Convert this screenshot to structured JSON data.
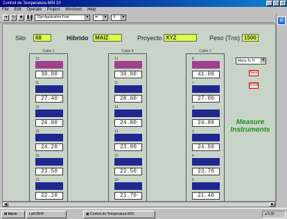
{
  "window": {
    "title": "Control de Temperatura MSI 10"
  },
  "menu": [
    "File",
    "Edit",
    "Operate",
    "Project",
    "Windows",
    "Help"
  ],
  "toolbar": {
    "font_select": "13pt Application Font"
  },
  "header": {
    "silo_label": "Silo",
    "silo_value": "68",
    "hibrido_label": "Hibrido",
    "hibrido_value": "MAIZ",
    "proyecto_label": "Proyecto",
    "proyecto_value": "XYZ",
    "peso_label": "Peso (Tns)",
    "peso_value": "1500"
  },
  "cables": [
    {
      "title": "Cable 1",
      "sensors": [
        {
          "label": "13",
          "color": "#a0408c",
          "temp": "38.00"
        },
        {
          "label": "11",
          "color": "#202890",
          "temp": "27.40"
        },
        {
          "label": "10",
          "color": "#202890",
          "temp": "26.00"
        },
        {
          "label": "13",
          "color": "#202890",
          "temp": "24.20"
        },
        {
          "label": "16",
          "color": "#202890",
          "temp": "23.50"
        },
        {
          "label": "13",
          "color": "#202890",
          "temp": "22.10"
        }
      ]
    },
    {
      "title": "Cable 8",
      "sensors": [
        {
          "label": "13",
          "color": "#a0408c",
          "temp": "39.00"
        },
        {
          "label": "11",
          "color": "#202890",
          "temp": "28.00"
        },
        {
          "label": "13",
          "color": "#202890",
          "temp": "24.80"
        },
        {
          "label": "13",
          "color": "#202890",
          "temp": "23.00"
        },
        {
          "label": "10",
          "color": "#202890",
          "temp": "22.50"
        },
        {
          "label": "10",
          "color": "#202890",
          "temp": "21.70"
        }
      ]
    },
    {
      "title": "Cable 2",
      "sensors": [
        {
          "label": "8",
          "color": "#a0408c",
          "temp": "41.00"
        },
        {
          "label": "7",
          "color": "#202890",
          "temp": "27.00"
        },
        {
          "label": "3",
          "color": "#202890",
          "temp": "24.80"
        },
        {
          "label": "3",
          "color": "#202890",
          "temp": "24.50"
        },
        {
          "label": "4",
          "color": "#202890",
          "temp": "23.70"
        },
        {
          "label": "5",
          "color": "#202890",
          "temp": "21.40"
        }
      ]
    }
  ],
  "right_panel": {
    "mode_select": "Menu To Tr",
    "btn_rect": "Rect",
    "btn_stop": "STOP",
    "measure_label": "Measure Instruments"
  },
  "taskbar": {
    "start": "Inicio",
    "item1": "LabVIEW",
    "item2": "Control de Temperatura MSI",
    "clock": "5:30"
  }
}
